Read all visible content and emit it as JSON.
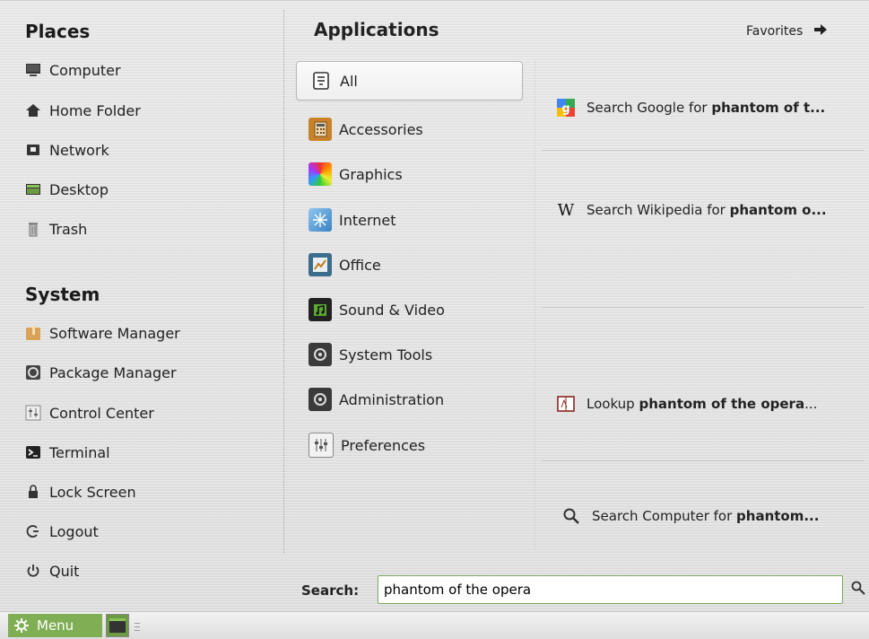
{
  "places": {
    "title": "Places",
    "items": [
      {
        "label": "Computer",
        "icon": "computer-icon"
      },
      {
        "label": "Home Folder",
        "icon": "home-icon"
      },
      {
        "label": "Network",
        "icon": "network-icon"
      },
      {
        "label": "Desktop",
        "icon": "desktop-icon"
      },
      {
        "label": "Trash",
        "icon": "trash-icon"
      }
    ]
  },
  "system": {
    "title": "System",
    "items": [
      {
        "label": "Software Manager",
        "icon": "software-manager-icon"
      },
      {
        "label": "Package Manager",
        "icon": "package-manager-icon"
      },
      {
        "label": "Control Center",
        "icon": "control-center-icon"
      },
      {
        "label": "Terminal",
        "icon": "terminal-icon"
      },
      {
        "label": "Lock Screen",
        "icon": "lock-icon"
      },
      {
        "label": "Logout",
        "icon": "logout-icon"
      },
      {
        "label": "Quit",
        "icon": "power-icon"
      }
    ]
  },
  "applications": {
    "title": "Applications",
    "selected": "All",
    "categories": [
      {
        "label": "All",
        "icon": "all-apps-icon"
      },
      {
        "label": "Accessories",
        "icon": "accessories-icon"
      },
      {
        "label": "Graphics",
        "icon": "graphics-icon"
      },
      {
        "label": "Internet",
        "icon": "internet-icon"
      },
      {
        "label": "Office",
        "icon": "office-icon"
      },
      {
        "label": "Sound & Video",
        "icon": "sound-video-icon"
      },
      {
        "label": "System Tools",
        "icon": "system-tools-icon"
      },
      {
        "label": "Administration",
        "icon": "administration-icon"
      },
      {
        "label": "Preferences",
        "icon": "preferences-icon"
      }
    ]
  },
  "favorites": {
    "label": "Favorites",
    "icon": "arrow-right-icon"
  },
  "results": [
    {
      "prefix": "Search Google for ",
      "bold": "phantom of t...",
      "suffix": "",
      "icon": "google-icon"
    },
    {
      "prefix": "Search Wikipedia for ",
      "bold": "phantom o...",
      "suffix": "",
      "icon": "wikipedia-icon"
    },
    {
      "prefix": "Lookup ",
      "bold": "phantom of the opera",
      "suffix": "...",
      "icon": "dictionary-icon"
    },
    {
      "prefix": "Search Computer for ",
      "bold": "phantom...",
      "suffix": "",
      "icon": "search-icon"
    }
  ],
  "search": {
    "label": "Search:",
    "value": "phantom of the opera"
  },
  "panel": {
    "menu_label": "Menu"
  },
  "colors": {
    "accent": "#7fae54",
    "input_border": "#7aa95c"
  }
}
